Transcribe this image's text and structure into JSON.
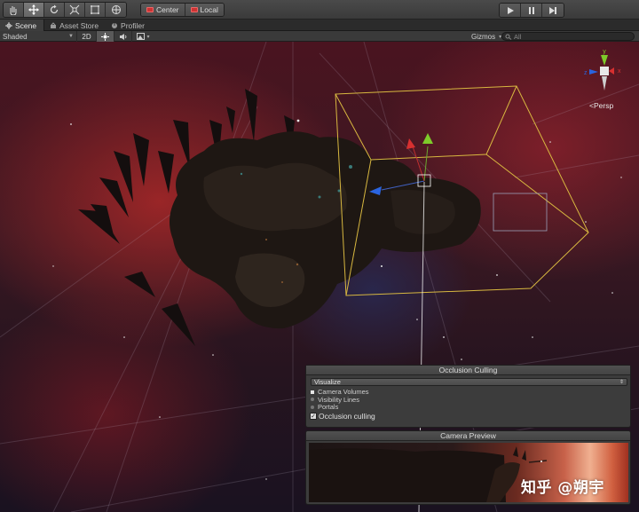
{
  "toolbar": {
    "tools": [
      {
        "icon": "hand-icon"
      },
      {
        "icon": "move-icon"
      },
      {
        "icon": "rotate-icon"
      },
      {
        "icon": "scale-icon"
      },
      {
        "icon": "rect-icon"
      },
      {
        "icon": "transform-icon"
      }
    ],
    "active_tool_index": 1,
    "pivot_label": "Center",
    "space_label": "Local",
    "play_controls": [
      {
        "icon": "play-icon"
      },
      {
        "icon": "pause-icon"
      },
      {
        "icon": "step-icon"
      }
    ]
  },
  "tabs": [
    {
      "label": "Scene",
      "icon": "scene-icon",
      "active": true
    },
    {
      "label": "Asset Store",
      "icon": "store-icon",
      "active": false
    },
    {
      "label": "Profiler",
      "icon": "profiler-icon",
      "active": false
    }
  ],
  "scene_toolbar": {
    "draw_mode": "Shaded",
    "mode_2d": "2D",
    "lighting_icon": "sun-icon",
    "audio_icon": "audio-icon",
    "effects_icon": "image-icon",
    "gizmos_label": "Gizmos",
    "search_placeholder": "All"
  },
  "gizmo": {
    "axes": {
      "y": "y",
      "x": "x",
      "z": "z"
    },
    "projection": "Persp"
  },
  "occlusion_panel": {
    "title": "Occlusion Culling",
    "visualize_label": "Visualize",
    "options": [
      {
        "label": "Camera Volumes",
        "on": true
      },
      {
        "label": "Visibility Lines",
        "on": false
      },
      {
        "label": "Portals",
        "on": false
      }
    ],
    "occlusion_checkbox_label": "Occlusion culling",
    "occlusion_checked": true
  },
  "camera_preview": {
    "title": "Camera Preview"
  },
  "watermark": "知乎 @朔宇",
  "colors": {
    "bounds_box": "#d8b840",
    "handle_y": "#7ecb2a",
    "handle_x": "#d83030",
    "handle_z": "#2a64e0"
  }
}
